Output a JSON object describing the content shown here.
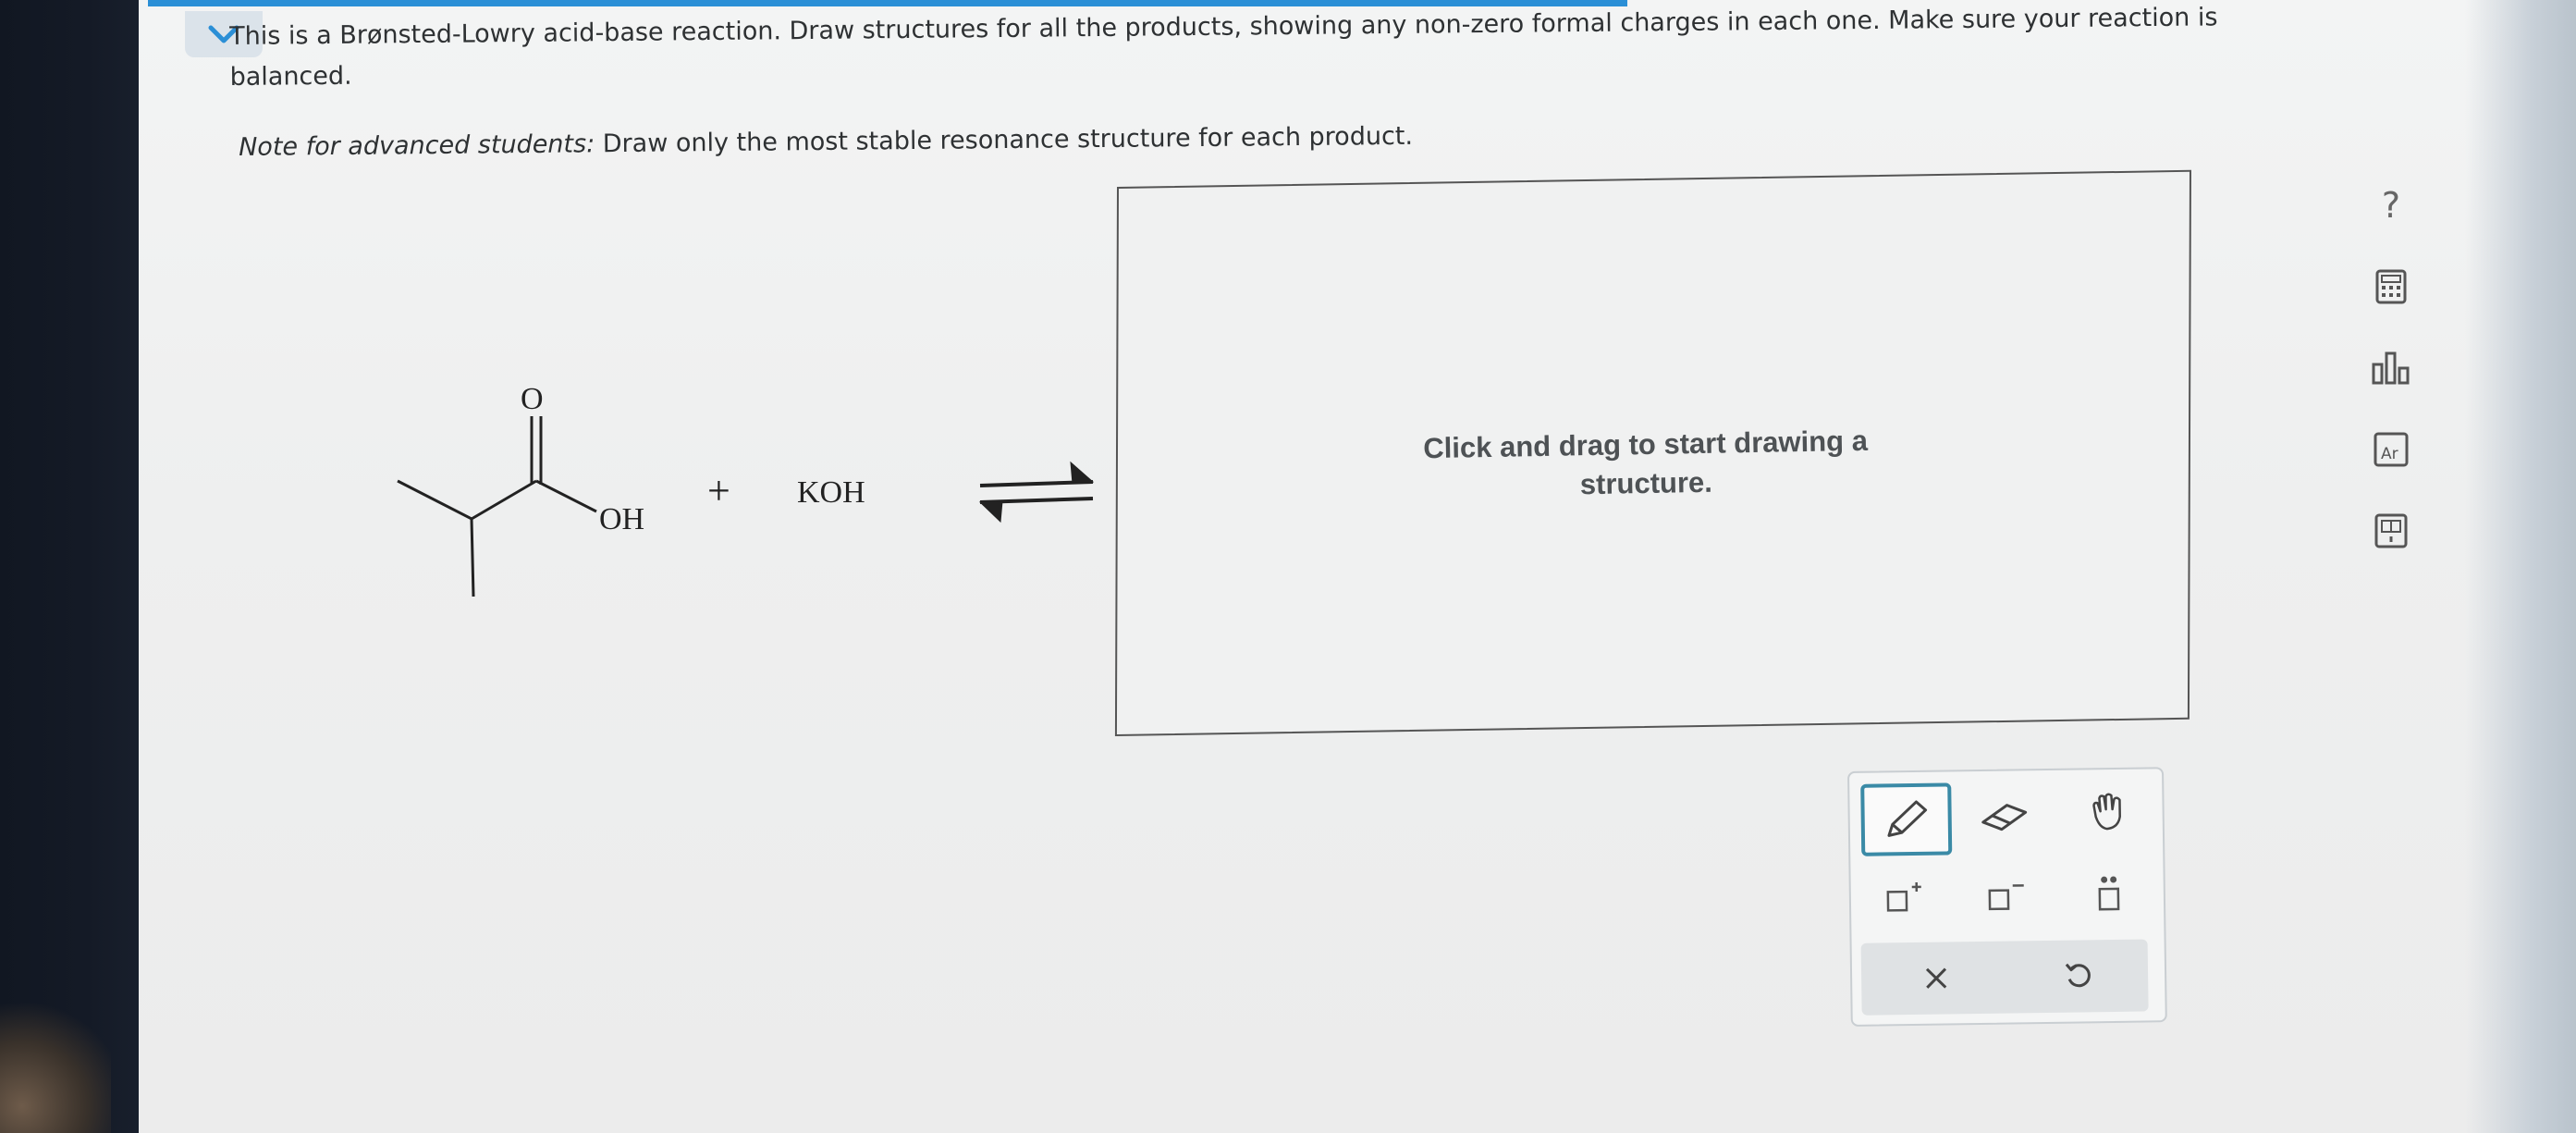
{
  "prompt": {
    "line1": "This is a Brønsted-Lowry acid-base reaction. Draw structures for all the products, showing any non-zero formal charges in each one. Make sure your reaction is",
    "line2": "balanced.",
    "note_label": "Note for advanced students:",
    "note_text": " Draw only the most stable resonance structure for each product."
  },
  "reaction": {
    "carbonyl_oxygen": "O",
    "hydroxyl": "OH",
    "plus": "+",
    "reagent": "KOH"
  },
  "drawing_area": {
    "hint_line1": "Click and drag to start drawing a",
    "hint_line2": "structure."
  },
  "side_tools": {
    "help": "?",
    "periodic_label": "Ar"
  },
  "colors": {
    "accent": "#2b8fd6",
    "active_tool_border": "#3a8aa6"
  }
}
